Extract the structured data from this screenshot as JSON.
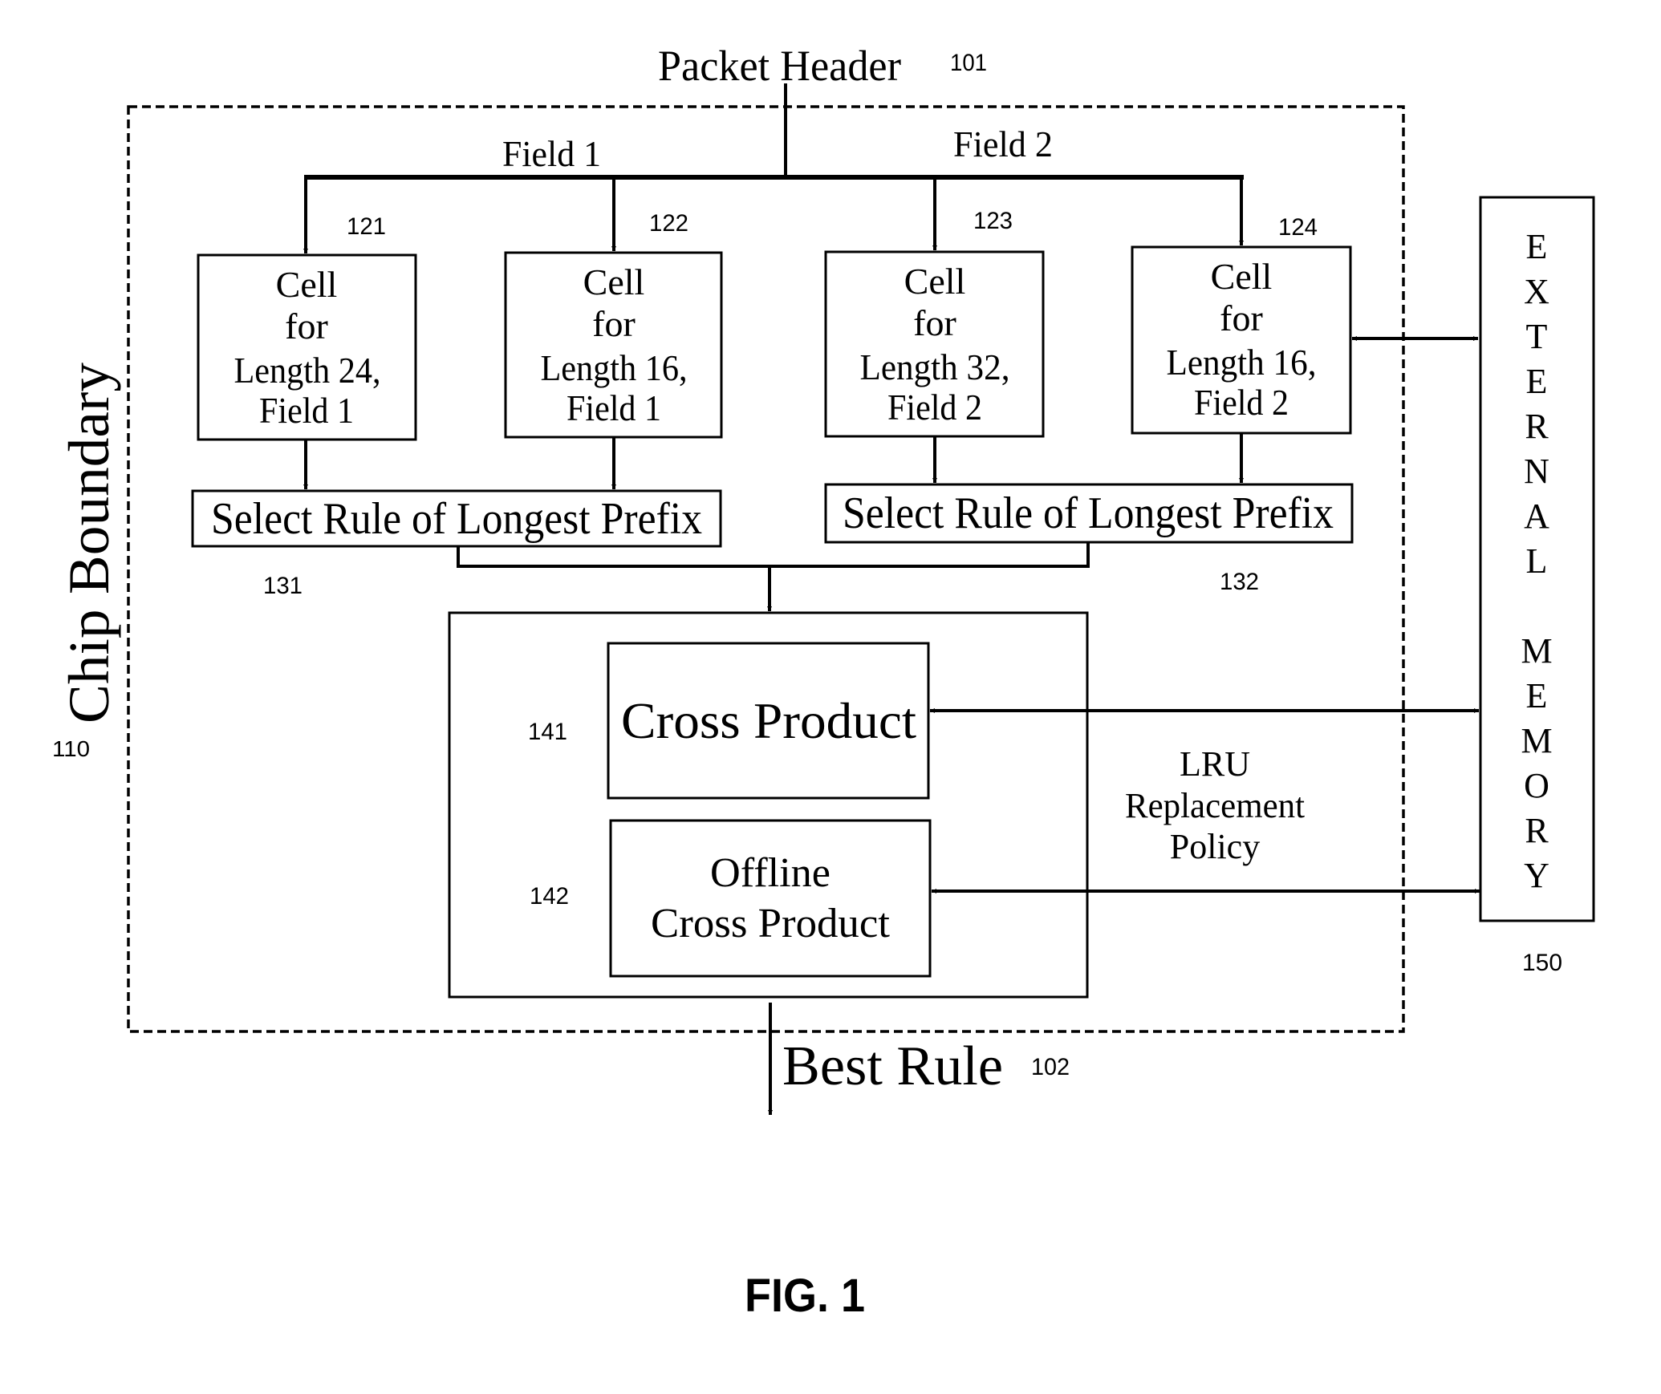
{
  "figure": {
    "caption": "FIG. 1",
    "input": {
      "label": "Packet Header",
      "ref": "101"
    },
    "output": {
      "label": "Best Rule",
      "ref": "102"
    },
    "chip_boundary": {
      "label": "Chip Boundary",
      "ref": "110"
    },
    "fields": {
      "field1": "Field 1",
      "field2": "Field 2"
    },
    "cells": [
      {
        "ref": "121",
        "lines": [
          "Cell",
          "for",
          "Length 24,",
          "Field 1"
        ]
      },
      {
        "ref": "122",
        "lines": [
          "Cell",
          "for",
          "Length 16,",
          "Field 1"
        ]
      },
      {
        "ref": "123",
        "lines": [
          "Cell",
          "for",
          "Length 32,",
          "Field 2"
        ]
      },
      {
        "ref": "124",
        "lines": [
          "Cell",
          "for",
          "Length 16,",
          "Field 2"
        ]
      }
    ],
    "selectors": [
      {
        "ref": "131",
        "label": "Select Rule of Longest Prefix"
      },
      {
        "ref": "132",
        "label": "Select Rule of Longest Prefix"
      }
    ],
    "cross_product": {
      "ref": "141",
      "label": "Cross Product"
    },
    "offline_cross_product": {
      "ref": "142",
      "lines": [
        "Offline",
        "Cross Product"
      ]
    },
    "policy": {
      "lines": [
        "LRU",
        "Replacement",
        "Policy"
      ]
    },
    "external_memory": {
      "ref": "150",
      "letters": [
        "E",
        "X",
        "T",
        "E",
        "R",
        "N",
        "A",
        "L",
        "",
        "M",
        "E",
        "M",
        "O",
        "R",
        "Y"
      ]
    }
  }
}
